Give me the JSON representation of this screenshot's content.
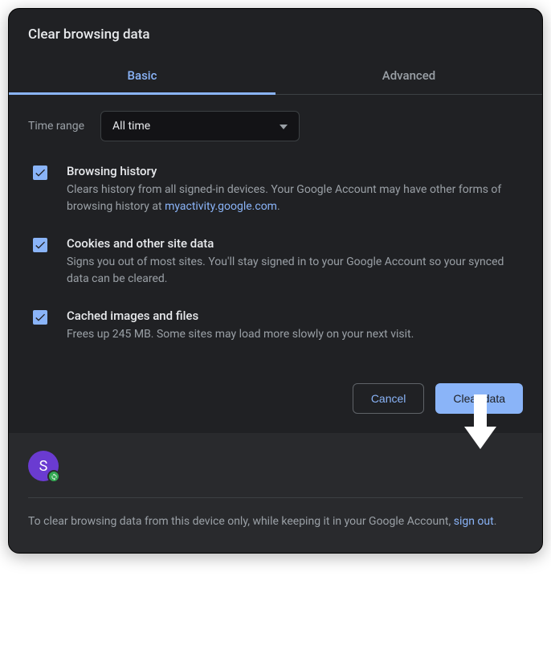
{
  "title": "Clear browsing data",
  "tabs": {
    "basic": "Basic",
    "advanced": "Advanced"
  },
  "timeRange": {
    "label": "Time range",
    "value": "All time"
  },
  "options": {
    "browsing": {
      "title": "Browsing history",
      "desc_pre": "Clears history from all signed-in devices. Your Google Account may have other forms of browsing history at ",
      "link": "myactivity.google.com",
      "desc_post": "."
    },
    "cookies": {
      "title": "Cookies and other site data",
      "desc": "Signs you out of most sites. You'll stay signed in to your Google Account so your synced data can be cleared."
    },
    "cache": {
      "title": "Cached images and files",
      "desc": "Frees up 245 MB. Some sites may load more slowly on your next visit."
    }
  },
  "buttons": {
    "cancel": "Cancel",
    "clear": "Clear data"
  },
  "avatar": {
    "initial": "S"
  },
  "footer": {
    "text_pre": "To clear browsing data from this device only, while keeping it in your Google Account, ",
    "link": "sign out",
    "text_post": "."
  }
}
